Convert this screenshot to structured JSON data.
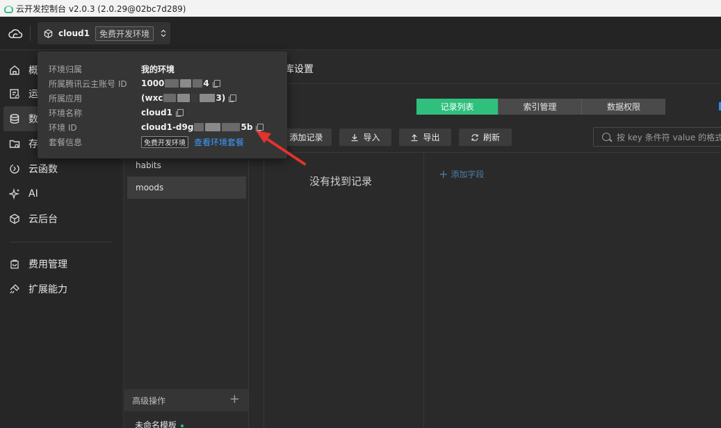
{
  "window": {
    "title": "云开发控制台 v2.0.3 (2.0.29@02bc7d289)"
  },
  "header": {
    "env_name": "cloud1",
    "env_tag": "免费开发环境",
    "chevron": "⌃⌄"
  },
  "sidebar": {
    "items": [
      {
        "label": "概",
        "icon": "home-icon"
      },
      {
        "label": "运",
        "icon": "ops-icon"
      },
      {
        "label": "数",
        "icon": "database-icon",
        "active": true
      },
      {
        "label": "存",
        "icon": "folder-icon"
      },
      {
        "label": "云函数",
        "icon": "function-icon"
      },
      {
        "label": "AI",
        "icon": "sparkle-icon"
      },
      {
        "label": "云后台",
        "icon": "cube-icon"
      },
      {
        "label": "费用管理",
        "icon": "bag-icon"
      },
      {
        "label": "扩展能力",
        "icon": "extension-icon"
      }
    ]
  },
  "collections": {
    "items": [
      "habits",
      "moods"
    ],
    "advanced_label": "高级操作",
    "advanced_plus": "+",
    "template_label": "未命名模板"
  },
  "main": {
    "title": "库设置",
    "tabs": [
      "记录列表",
      "索引管理",
      "数据权限"
    ],
    "toolbar": {
      "add_record": "添加记录",
      "import": "导入",
      "export": "导出",
      "refresh": "刷新"
    },
    "search_placeholder": "按 key 条件符 value 的格式",
    "empty_text": "没有找到记录",
    "add_field": "添加字段"
  },
  "popover": {
    "rows": [
      {
        "label": "环境归属",
        "value": "我的环境"
      },
      {
        "label": "所属腾讯云主账号 ID",
        "value_start": "1000",
        "value_end": "4"
      },
      {
        "label": "所属应用",
        "value_start": "(wxc",
        "value_end": "3)"
      },
      {
        "label": "环境名称",
        "value": "cloud1"
      },
      {
        "label": "环境 ID",
        "value_start": "cloud1-d9g",
        "value_end": "5b"
      },
      {
        "label": "套餐信息",
        "tag": "免费开发环境",
        "link": "查看环境套餐"
      }
    ]
  },
  "colors": {
    "accent_green": "#2fc07d",
    "link_blue": "#3b9bff",
    "arrow_red": "#e5322d"
  }
}
